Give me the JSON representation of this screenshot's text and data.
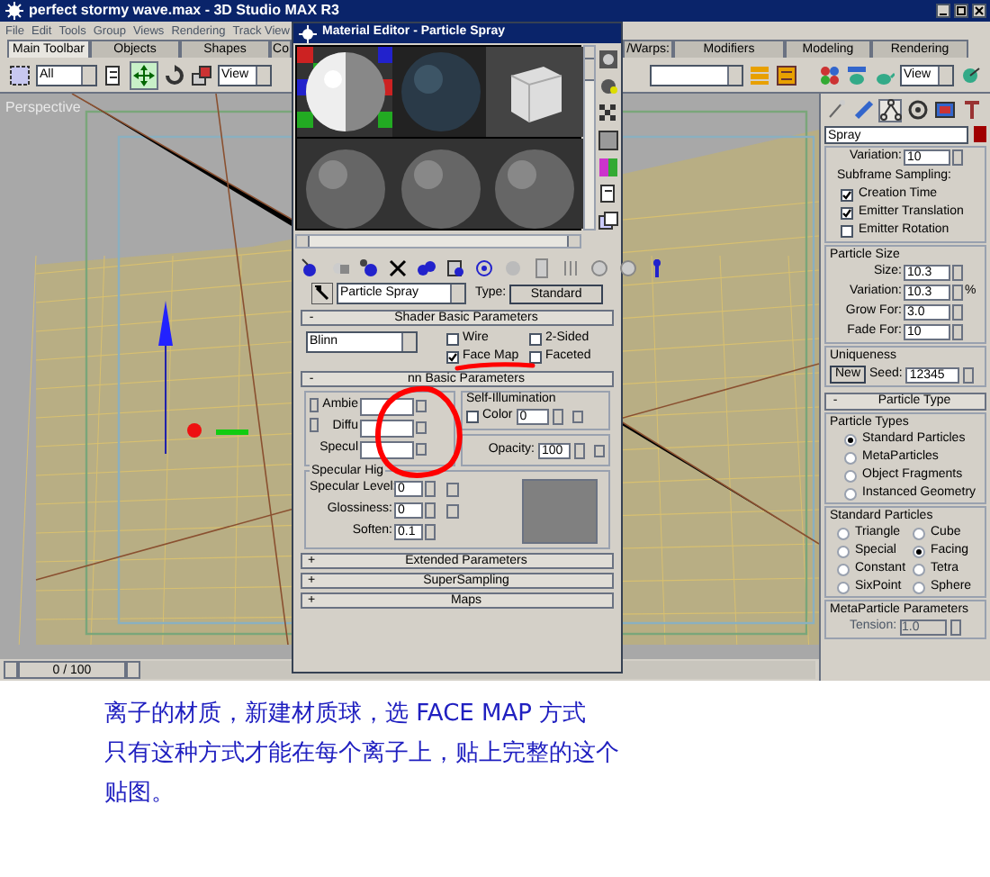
{
  "main_window": {
    "title": "perfect stormy wave.max - 3D Studio MAX R3",
    "menu": [
      "File",
      "Edit",
      "Tools",
      "Group",
      "Views",
      "Rendering",
      "Track View"
    ],
    "tabs_left": [
      {
        "label": "Main Toolbar",
        "selected": true
      },
      {
        "label": "Objects",
        "selected": false
      },
      {
        "label": "Shapes",
        "selected": false
      },
      {
        "label": "Co",
        "selected": false
      }
    ],
    "tabs_right": [
      {
        "label": "/Warps:",
        "selected": false
      },
      {
        "label": "Modifiers",
        "selected": false
      },
      {
        "label": "Modeling",
        "selected": false
      },
      {
        "label": "Rendering",
        "selected": false
      }
    ],
    "selection_filter": "All",
    "view_left": "View",
    "view_right": "View",
    "viewport_label": "Perspective",
    "time_slider": {
      "text": "0 / 100",
      "level": 0
    }
  },
  "material_editor": {
    "title": "Material Editor - Particle Spray",
    "material_name": "Particle Spray",
    "type_label": "Type:",
    "type_value": "Standard",
    "shader": {
      "sign": "-",
      "title": "Shader Basic Parameters",
      "shader": "Blinn",
      "options": [
        {
          "label": "Wire",
          "checked": false
        },
        {
          "label": "2-Sided",
          "checked": false
        },
        {
          "label": "Face Map",
          "checked": true
        },
        {
          "label": "Faceted",
          "checked": false
        }
      ]
    },
    "basic": {
      "sign": "-",
      "title": "nn Basic Parameters",
      "colors": [
        "Ambie",
        "Diffu",
        "Specul"
      ],
      "self_illum": {
        "title": "Self-Illumination",
        "label": "Color",
        "checked": false,
        "value": "0"
      },
      "opacity": {
        "label": "Opacity:",
        "value": "100"
      },
      "highlights": {
        "title": "Specular Hig",
        "fields": [
          {
            "label": "Specular Level:",
            "value": "0"
          },
          {
            "label": "Glossiness:",
            "value": "0"
          },
          {
            "label": "Soften:",
            "value": "0.1"
          }
        ]
      }
    },
    "collapsed": [
      {
        "sign": "+",
        "label": "Extended Parameters"
      },
      {
        "sign": "+",
        "label": "SuperSampling"
      },
      {
        "sign": "+",
        "label": "Maps"
      }
    ]
  },
  "command_panel": {
    "object_name": "Spray",
    "variation": {
      "label": "Variation:",
      "value": "10"
    },
    "subframe": {
      "title": "Subframe Sampling:",
      "options": [
        {
          "label": "Creation Time",
          "checked": true
        },
        {
          "label": "Emitter Translation",
          "checked": true
        },
        {
          "label": "Emitter Rotation",
          "checked": false
        }
      ]
    },
    "particle_size": {
      "title": "Particle Size",
      "fields": [
        {
          "label": "Size:",
          "value": "10.3"
        },
        {
          "label": "Variation:",
          "value": "10.3",
          "unit": "%"
        },
        {
          "label": "Grow For:",
          "value": "3.0"
        },
        {
          "label": "Fade For:",
          "value": "10"
        }
      ]
    },
    "uniqueness": {
      "title": "Uniqueness",
      "button": "New",
      "label": "Seed:",
      "value": "12345"
    },
    "particle_type": {
      "sign": "-",
      "title": "Particle Type"
    },
    "particle_types": {
      "title": "Particle Types",
      "options": [
        {
          "label": "Standard Particles",
          "selected": true
        },
        {
          "label": "MetaParticles",
          "selected": false
        },
        {
          "label": "Object Fragments",
          "selected": false
        },
        {
          "label": "Instanced Geometry",
          "selected": false
        }
      ]
    },
    "standard_particles": {
      "title": "Standard Particles",
      "options": [
        {
          "label": "Triangle",
          "selected": false
        },
        {
          "label": "Cube",
          "selected": false
        },
        {
          "label": "Special",
          "selected": false
        },
        {
          "label": "Facing",
          "selected": true
        },
        {
          "label": "Constant",
          "selected": false
        },
        {
          "label": "Tetra",
          "selected": false
        },
        {
          "label": "SixPoint",
          "selected": false
        },
        {
          "label": "Sphere",
          "selected": false
        }
      ]
    },
    "metaparticle": {
      "title": "MetaParticle Parameters",
      "label": "Tension:",
      "value": "1.0",
      "disabled": true
    }
  },
  "caption": [
    "离子的材质，新建材质球，选 FACE MAP 方式",
    "只有这种方式才能在每个离子上，贴上完整的这个",
    "贴图。"
  ]
}
